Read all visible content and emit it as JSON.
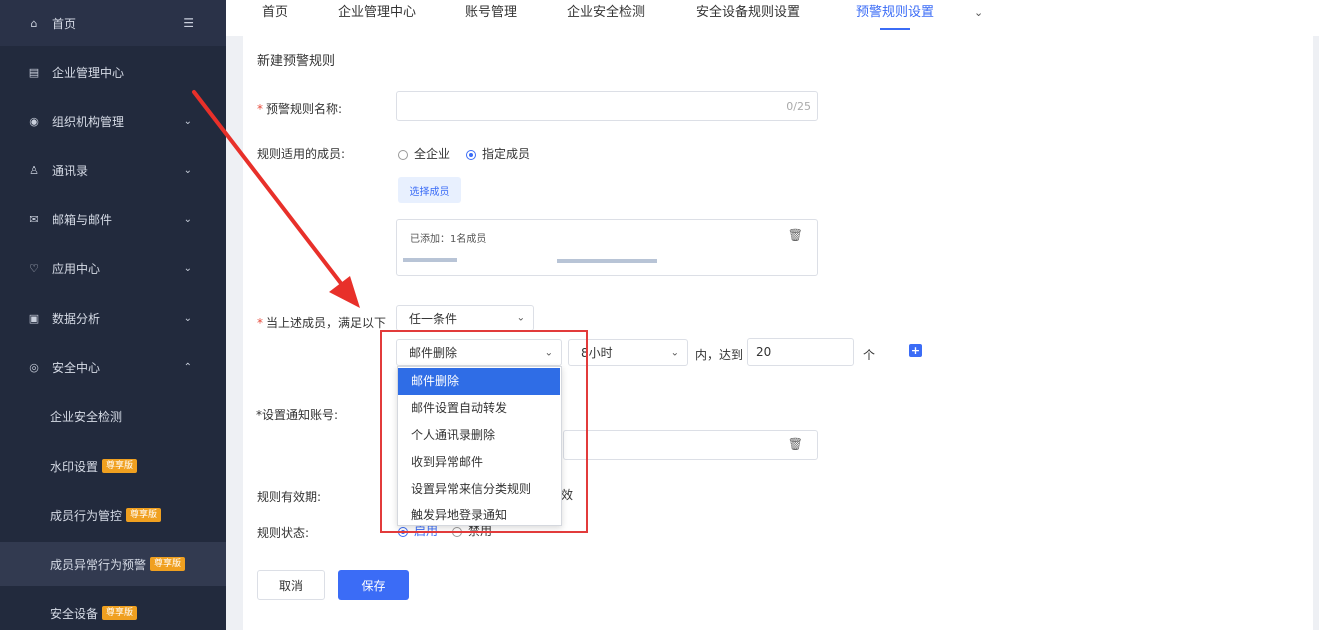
{
  "sidebar": {
    "items": [
      {
        "label": "首页",
        "icon": "home-icon"
      },
      {
        "label": "企业管理中心",
        "icon": "building-icon"
      },
      {
        "label": "组织机构管理",
        "icon": "org-icon"
      },
      {
        "label": "通讯录",
        "icon": "contacts-icon"
      },
      {
        "label": "邮箱与邮件",
        "icon": "mail-icon"
      },
      {
        "label": "应用中心",
        "icon": "app-icon"
      },
      {
        "label": "数据分析",
        "icon": "chart-icon"
      },
      {
        "label": "安全中心",
        "icon": "shield-icon"
      }
    ],
    "sub_items": [
      {
        "label": "企业安全检测"
      },
      {
        "label": "水印设置",
        "badge": "尊享版"
      },
      {
        "label": "成员行为管控",
        "badge": "尊享版"
      },
      {
        "label": "成员异常行为预警",
        "badge": "尊享版"
      },
      {
        "label": "安全设备",
        "badge": "尊享版"
      }
    ]
  },
  "topnav": {
    "tabs": [
      "首页",
      "企业管理中心",
      "账号管理",
      "企业安全检测",
      "安全设备规则设置",
      "预警规则设置"
    ],
    "more": "⌄"
  },
  "form": {
    "title": "新建预警规则",
    "name_label": "预警规则名称:",
    "name_counter": "0/25",
    "members_label": "规则适用的成员:",
    "radio_all": "全企业",
    "radio_specific": "指定成员",
    "choose_button": "选择成员",
    "added_text": "已添加：1名成员",
    "condition_label": "当上述成员，满足以下",
    "condition_select": "任一条件",
    "event_select": "邮件删除",
    "time_select": "8小时",
    "within_text": "内，达到",
    "count_value": "20",
    "unit_text": "个",
    "notify_label": "*设置通知账号:",
    "validity_label": "规则有效期:",
    "validity_tail": "效",
    "status_label": "规则状态:",
    "status_on": "启用",
    "status_off": "禁用",
    "cancel": "取消",
    "save": "保存"
  },
  "dropdown": {
    "options": [
      "邮件删除",
      "邮件设置自动转发",
      "个人通讯录删除",
      "收到异常邮件",
      "设置异常来信分类规则",
      "触发异地登录通知"
    ],
    "selected": "邮件删除"
  },
  "colors": {
    "accent": "#3b6cf6",
    "sidebar_bg": "#222a3d",
    "highlight_box": "#e23b3b",
    "badge": "#f0a020"
  }
}
